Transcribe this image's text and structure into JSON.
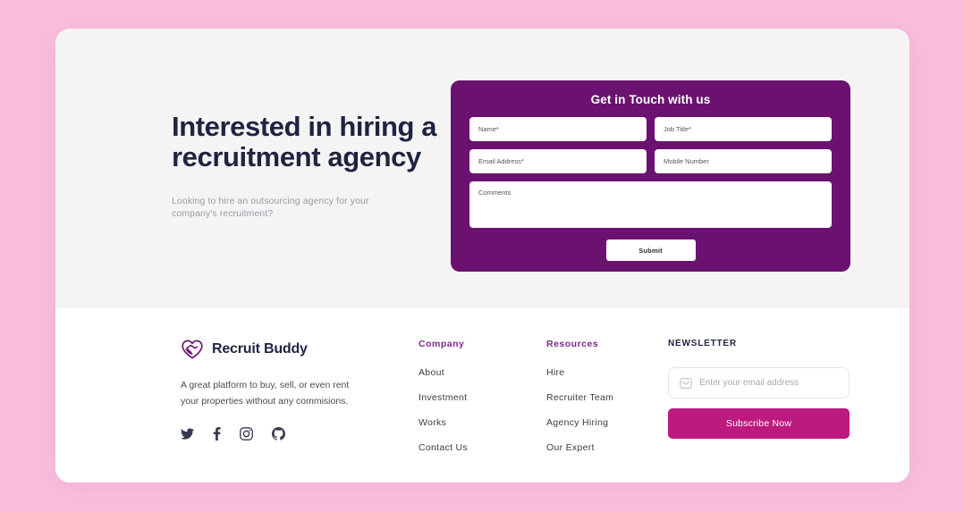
{
  "hero": {
    "title": "Interested in hiring a recruitment agency",
    "subtitle": "Looking to hire an outsourcing agency for your company's recruitment?"
  },
  "contact_form": {
    "title": "Get in Touch with us",
    "fields": [
      {
        "name": "name",
        "placeholder": "Name*",
        "value": ""
      },
      {
        "name": "job_title",
        "placeholder": "Job Title*",
        "value": ""
      },
      {
        "name": "email",
        "placeholder": "Email Address*",
        "value": ""
      },
      {
        "name": "mobile",
        "placeholder": "Mobile Number",
        "value": ""
      },
      {
        "name": "comments",
        "placeholder": "Comments",
        "value": ""
      }
    ],
    "submit_label": "Submit",
    "panel_color": "#6b1270"
  },
  "footer": {
    "brand": {
      "name": "Recruit Buddy",
      "logo_icon": "heart-handshake-icon",
      "description": "A great platform to buy, sell, or even rent your properties without any commisions."
    },
    "social": [
      {
        "icon": "twitter-icon",
        "label": "Twitter"
      },
      {
        "icon": "facebook-icon",
        "label": "Facebook"
      },
      {
        "icon": "instagram-icon",
        "label": "Instagram"
      },
      {
        "icon": "github-icon",
        "label": "GitHub"
      }
    ],
    "columns": [
      {
        "heading": "Company",
        "links": [
          "About",
          "Investment",
          "Works",
          "Contact Us"
        ]
      },
      {
        "heading": "Resources",
        "links": [
          "Hire",
          "Recruiter Team",
          "Agency Hiring",
          "Our Expert"
        ]
      }
    ],
    "newsletter": {
      "heading": "NEWSLETTER",
      "input_placeholder": "Enter your email address",
      "input_value": "",
      "input_icon": "envelope-icon",
      "button_label": "Subscribe Now",
      "button_color": "#bc1a7e"
    }
  },
  "theme": {
    "page_background": "#f9bedd",
    "card_background": "#ffffff",
    "hero_background": "#f5f4f5",
    "heading_color": "#1f2440",
    "accent_purple": "#7b2a8c",
    "accent_magenta": "#bc1a7e"
  }
}
